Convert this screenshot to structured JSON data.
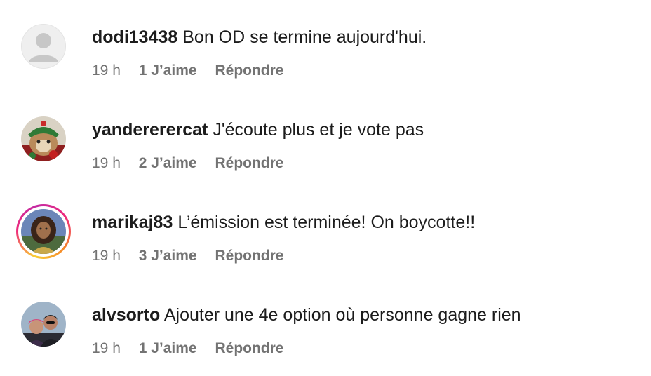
{
  "comments": [
    {
      "username": "dodi13438",
      "text": "Bon OD se termine aujourd'hui.",
      "time": "19 h",
      "likes": "1 J’aime",
      "reply": "Répondre",
      "avatar": "default-avatar-icon"
    },
    {
      "username": "yandererercat",
      "text": "J'écoute plus et je vote pas",
      "time": "19 h",
      "likes": "2 J’aime",
      "reply": "Répondre",
      "avatar": "cat-photo"
    },
    {
      "username": "marikaj83",
      "text": "L’émission est terminée! On boycotte!!",
      "time": "19 h",
      "likes": "3 J’aime",
      "reply": "Répondre",
      "avatar": "person-photo",
      "has_story_ring": true
    },
    {
      "username": "alvsorto",
      "text": "Ajouter une 4e option où personne gagne rien",
      "time": "19 h",
      "likes": "1 J’aime",
      "reply": "Répondre",
      "avatar": "couple-photo"
    }
  ],
  "colors": {
    "text": "#1c1c1c",
    "meta": "#737373",
    "story_ring": [
      "#f9ce34",
      "#ee2a7b",
      "#c32aa3"
    ]
  }
}
